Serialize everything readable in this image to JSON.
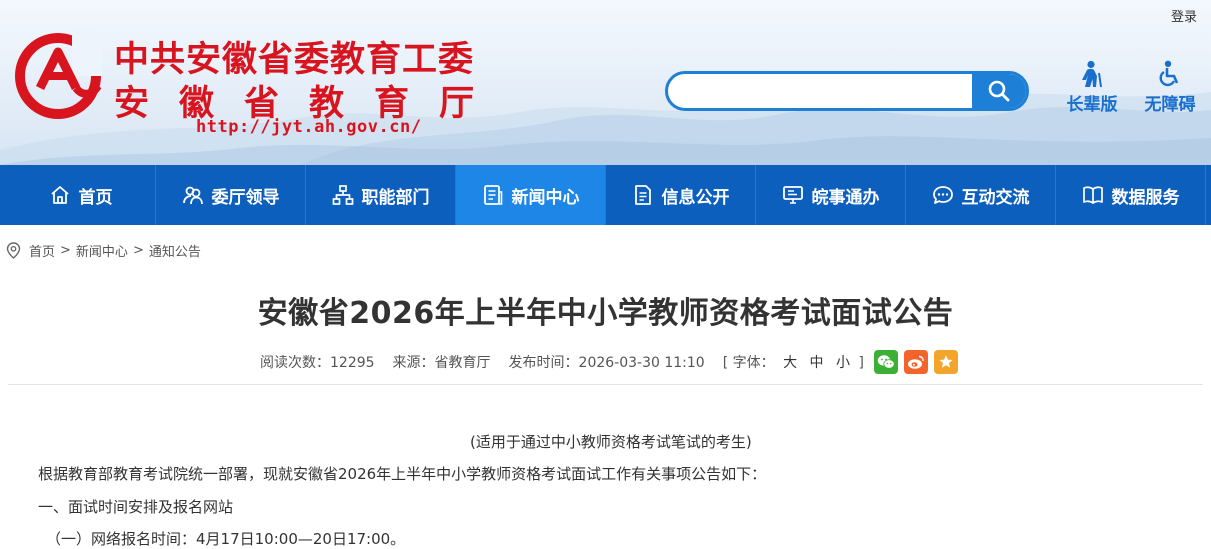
{
  "header": {
    "login_label": "登录",
    "org_name_line1": "中共安徽省委教育工委",
    "org_name_line2": "安徽省教育厅",
    "website_url": "http://jyt.ah.gov.cn/",
    "search": {
      "value": "",
      "placeholder": ""
    },
    "accessibility": {
      "elder_mode_label": "长辈版",
      "barrier_free_label": "无障碍"
    }
  },
  "nav": {
    "items": [
      {
        "label": "首页",
        "icon": "home-icon"
      },
      {
        "label": "委厅领导",
        "icon": "leaders-icon"
      },
      {
        "label": "职能部门",
        "icon": "org-chart-icon"
      },
      {
        "label": "新闻中心",
        "icon": "news-icon",
        "active": true
      },
      {
        "label": "信息公开",
        "icon": "document-icon"
      },
      {
        "label": "皖事通办",
        "icon": "monitor-icon"
      },
      {
        "label": "互动交流",
        "icon": "chat-icon"
      },
      {
        "label": "数据服务",
        "icon": "book-icon"
      }
    ]
  },
  "breadcrumb": {
    "items": [
      "首页",
      "新闻中心",
      "通知公告"
    ],
    "separator": ">"
  },
  "article": {
    "title": "安徽省2026年上半年中小学教师资格考试面试公告",
    "meta": {
      "read_count": "阅读次数：12295",
      "source": "来源：省教育厅",
      "publish_time": "发布时间：2026-03-30 11:10",
      "font_label": "[ 字体：",
      "font_large": "大",
      "font_medium": "中",
      "font_small": "小",
      "font_close": "]"
    },
    "share": [
      "wechat-icon",
      "weibo-icon",
      "favorite-icon"
    ],
    "body": {
      "subtitle": "(适用于通过中小教师资格考试笔试的考生)",
      "paragraph1": "根据教育部教育考试院统一部署，现就安徽省2026年上半年中小学教师资格考试面试工作有关事项公告如下：",
      "section1_heading": "一、面试时间安排及报名网站",
      "item1": "（一）网络报名时间：4月17日10:00—20日17:00。"
    }
  },
  "colors": {
    "brand_red": "#d8141e",
    "nav_blue": "#0d5fbe",
    "nav_active": "#1e86e6",
    "search_blue": "#1e7fd6",
    "wechat_green": "#3cb034",
    "weibo_orange": "#f2642b",
    "favorite_yellow": "#f3a52b"
  }
}
